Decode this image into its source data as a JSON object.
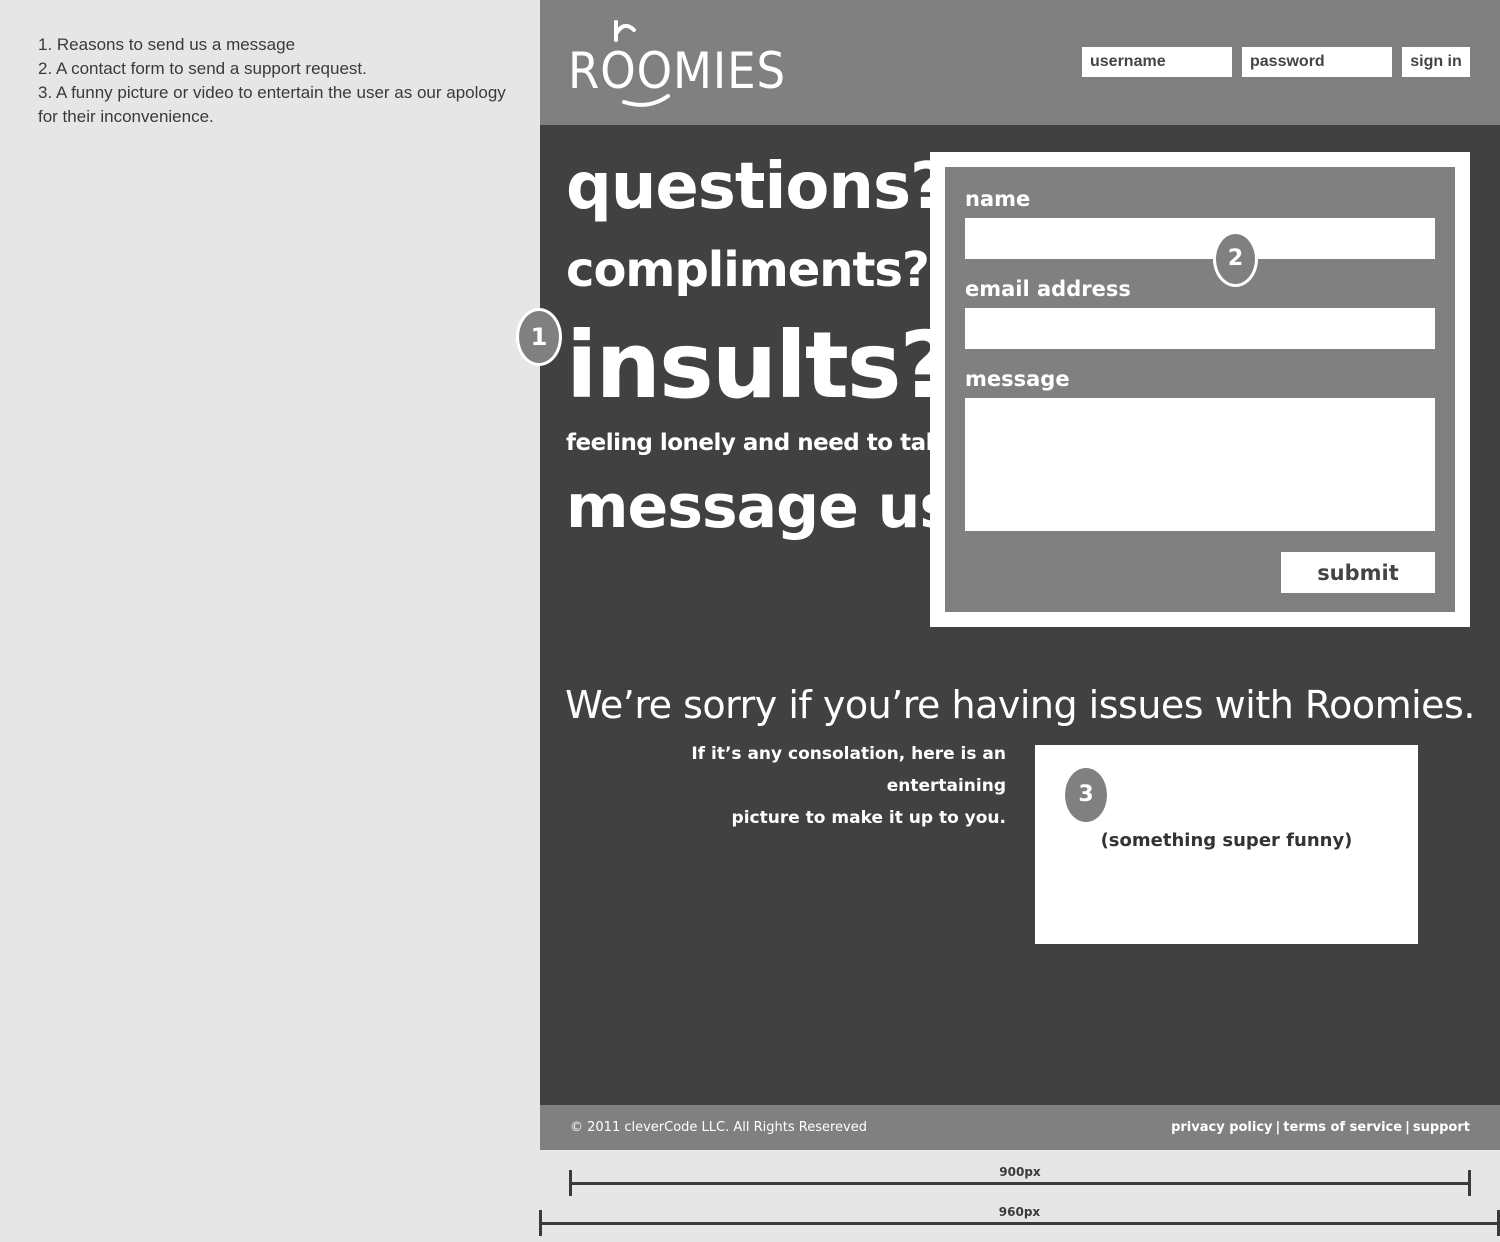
{
  "notes": [
    "1. Reasons to send us a message",
    "2. A contact form to send a support request.",
    "3. A funny picture or video to entertain the user as our apology for their inconvenience."
  ],
  "header": {
    "logo_text": "ROOMIES",
    "username_placeholder": "username",
    "password_placeholder": "password",
    "sign_in_label": "sign in"
  },
  "hero": {
    "questions": "questions?",
    "compliments": "compliments?",
    "insults": "insults?",
    "lonely": "feeling lonely and need to talk?",
    "message_us": "message us!"
  },
  "form": {
    "name_label": "name",
    "email_label": "email address",
    "message_label": "message",
    "submit_label": "submit"
  },
  "sorry": {
    "heading": "We’re sorry if you’re having issues with Roomies.",
    "consolation_line1": "If it’s any consolation, here is an entertaining",
    "consolation_line2": "picture to make it up to you.",
    "funny_caption": "(something super funny)"
  },
  "footer": {
    "copyright": "© 2011 cleverCode LLC. All Rights Resereved",
    "links": [
      "privacy policy",
      "terms of service",
      "support"
    ],
    "separator": "|"
  },
  "markers": [
    "1",
    "2",
    "3"
  ],
  "rulers": {
    "inner": "900px",
    "outer": "960px"
  },
  "colors": {
    "background": "#e6e6e6",
    "page_dark": "#414141",
    "panel_gray": "#808080",
    "white": "#ffffff"
  }
}
